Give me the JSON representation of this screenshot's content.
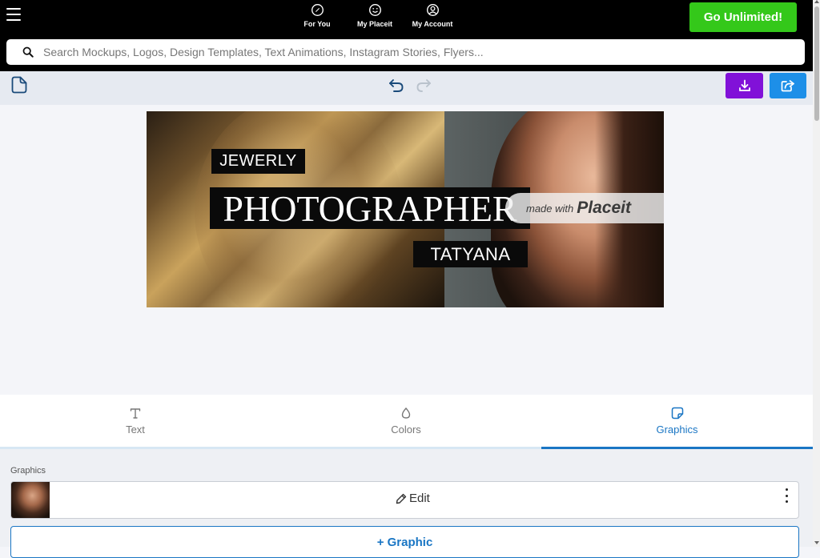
{
  "header": {
    "menu_icon": "hamburger-icon",
    "nav": [
      {
        "label": "For You",
        "icon": "compass-icon"
      },
      {
        "label": "My Placeit",
        "icon": "smiley-icon"
      },
      {
        "label": "My Account",
        "icon": "user-circle-icon"
      }
    ],
    "cta_label": "Go Unlimited!",
    "cta_color": "#34c81a"
  },
  "search": {
    "placeholder": "Search Mockups, Logos, Design Templates, Text Animations, Instagram Stories, Flyers..."
  },
  "toolbar": {
    "page_icon": "page-icon",
    "undo_icon": "undo-icon",
    "redo_icon": "redo-icon",
    "download_icon": "download-icon",
    "download_color": "#8111d8",
    "share_icon": "share-icon",
    "share_color": "#1d8fe8"
  },
  "canvas": {
    "line1": "JEWERLY",
    "line2": "PHOTOGRAPHER",
    "line3": "TATYANA",
    "watermark_made_with": "made with",
    "watermark_brand": "Placeit"
  },
  "tabs": [
    {
      "label": "Text",
      "icon": "text-icon"
    },
    {
      "label": "Colors",
      "icon": "drop-icon"
    },
    {
      "label": "Graphics",
      "icon": "sticker-icon",
      "active": true
    }
  ],
  "panel": {
    "title": "Graphics",
    "edit_label": "Edit",
    "add_label": "+ Graphic"
  },
  "accent_color": "#1a76c4"
}
